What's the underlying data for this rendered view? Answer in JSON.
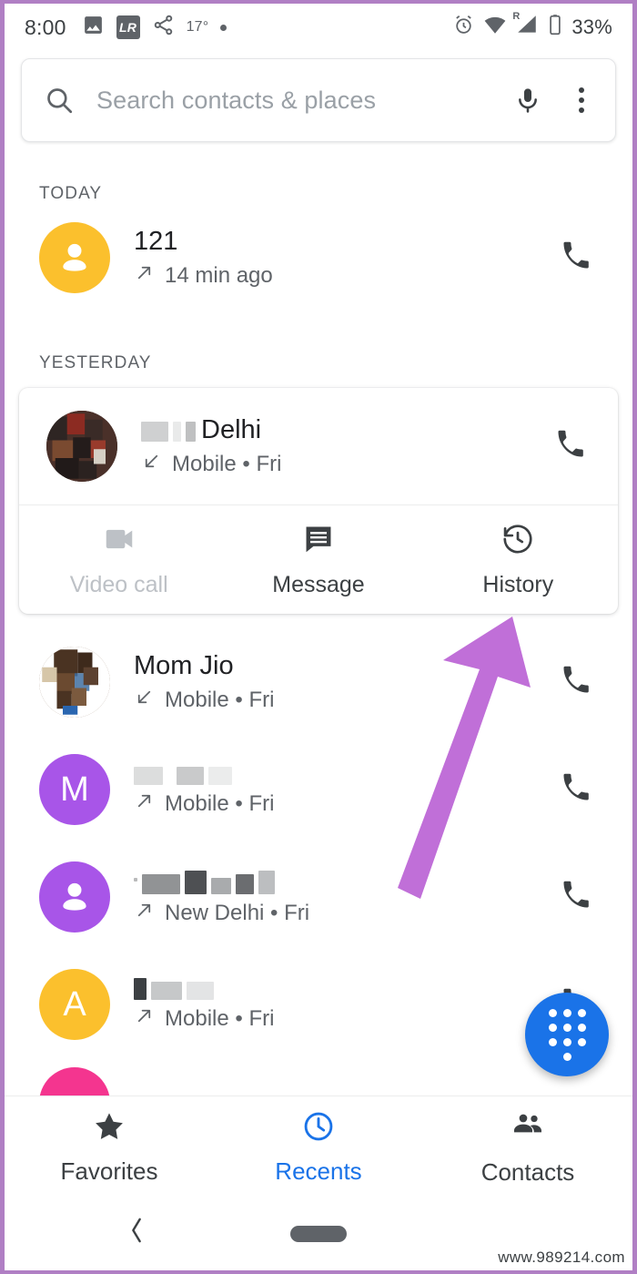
{
  "status_bar": {
    "time": "8:00",
    "temperature": "17°",
    "battery_percent": "33%",
    "icons_left": [
      "image-icon",
      "lr-badge-icon",
      "share-icon",
      "dot-icon"
    ],
    "lr_badge_text": "LR",
    "icons_right": [
      "alarm-icon",
      "wifi-icon",
      "signal-roaming-icon",
      "battery-icon"
    ]
  },
  "search": {
    "placeholder": "Search contacts & places",
    "search_icon": "search-icon",
    "mic_icon": "microphone-icon",
    "overflow_icon": "overflow-menu-icon"
  },
  "sections": [
    {
      "label": "TODAY"
    },
    {
      "label": "YESTERDAY"
    }
  ],
  "today_calls": [
    {
      "name": "121",
      "detail": "14 min ago",
      "direction": "outgoing",
      "avatar_type": "person-glyph",
      "avatar_color": "#fbc02d",
      "call_icon": "phone-icon"
    }
  ],
  "expanded_call": {
    "name": "Delhi",
    "name_redacted_prefix": true,
    "detail": "Mobile • Fri",
    "direction": "incoming",
    "avatar_type": "photo",
    "call_icon": "phone-icon",
    "actions": [
      {
        "label": "Video call",
        "icon": "video-camera-icon",
        "disabled": true
      },
      {
        "label": "Message",
        "icon": "message-icon",
        "disabled": false
      },
      {
        "label": "History",
        "icon": "history-icon",
        "disabled": false
      }
    ]
  },
  "recent_calls": [
    {
      "name": "Mom Jio",
      "detail": "Mobile • Fri",
      "direction": "incoming",
      "avatar_type": "photo",
      "avatar_color": "#6d4c32",
      "call_icon": "phone-icon",
      "redacted": false
    },
    {
      "name": "",
      "detail": "Mobile • Fri",
      "direction": "outgoing",
      "avatar_type": "initial",
      "avatar_initial": "M",
      "avatar_color": "#a855e8",
      "call_icon": "phone-icon",
      "redacted": true
    },
    {
      "name": "",
      "detail": "New Delhi • Fri",
      "direction": "outgoing",
      "avatar_type": "person-glyph",
      "avatar_color": "#a855e8",
      "call_icon": "phone-icon",
      "redacted": true
    },
    {
      "name": "",
      "detail": "Mobile • Fri",
      "direction": "outgoing",
      "avatar_type": "initial",
      "avatar_initial": "A",
      "avatar_color": "#fbc02d",
      "call_icon": "phone-icon",
      "redacted": true
    }
  ],
  "fab": {
    "icon": "dialpad-icon",
    "color": "#1a73e8"
  },
  "bottom_nav": {
    "active_color": "#1a73e8",
    "items": [
      {
        "label": "Favorites",
        "icon": "star-icon",
        "active": false
      },
      {
        "label": "Recents",
        "icon": "clock-icon",
        "active": true
      },
      {
        "label": "Contacts",
        "icon": "people-icon",
        "active": false
      }
    ]
  },
  "android_nav": {
    "back_icon": "back-chevron-icon",
    "home_icon": "home-pill-icon"
  },
  "annotation": {
    "type": "arrow",
    "color": "#c06fd8",
    "points_to": "History"
  },
  "watermark": "www.989214.com"
}
